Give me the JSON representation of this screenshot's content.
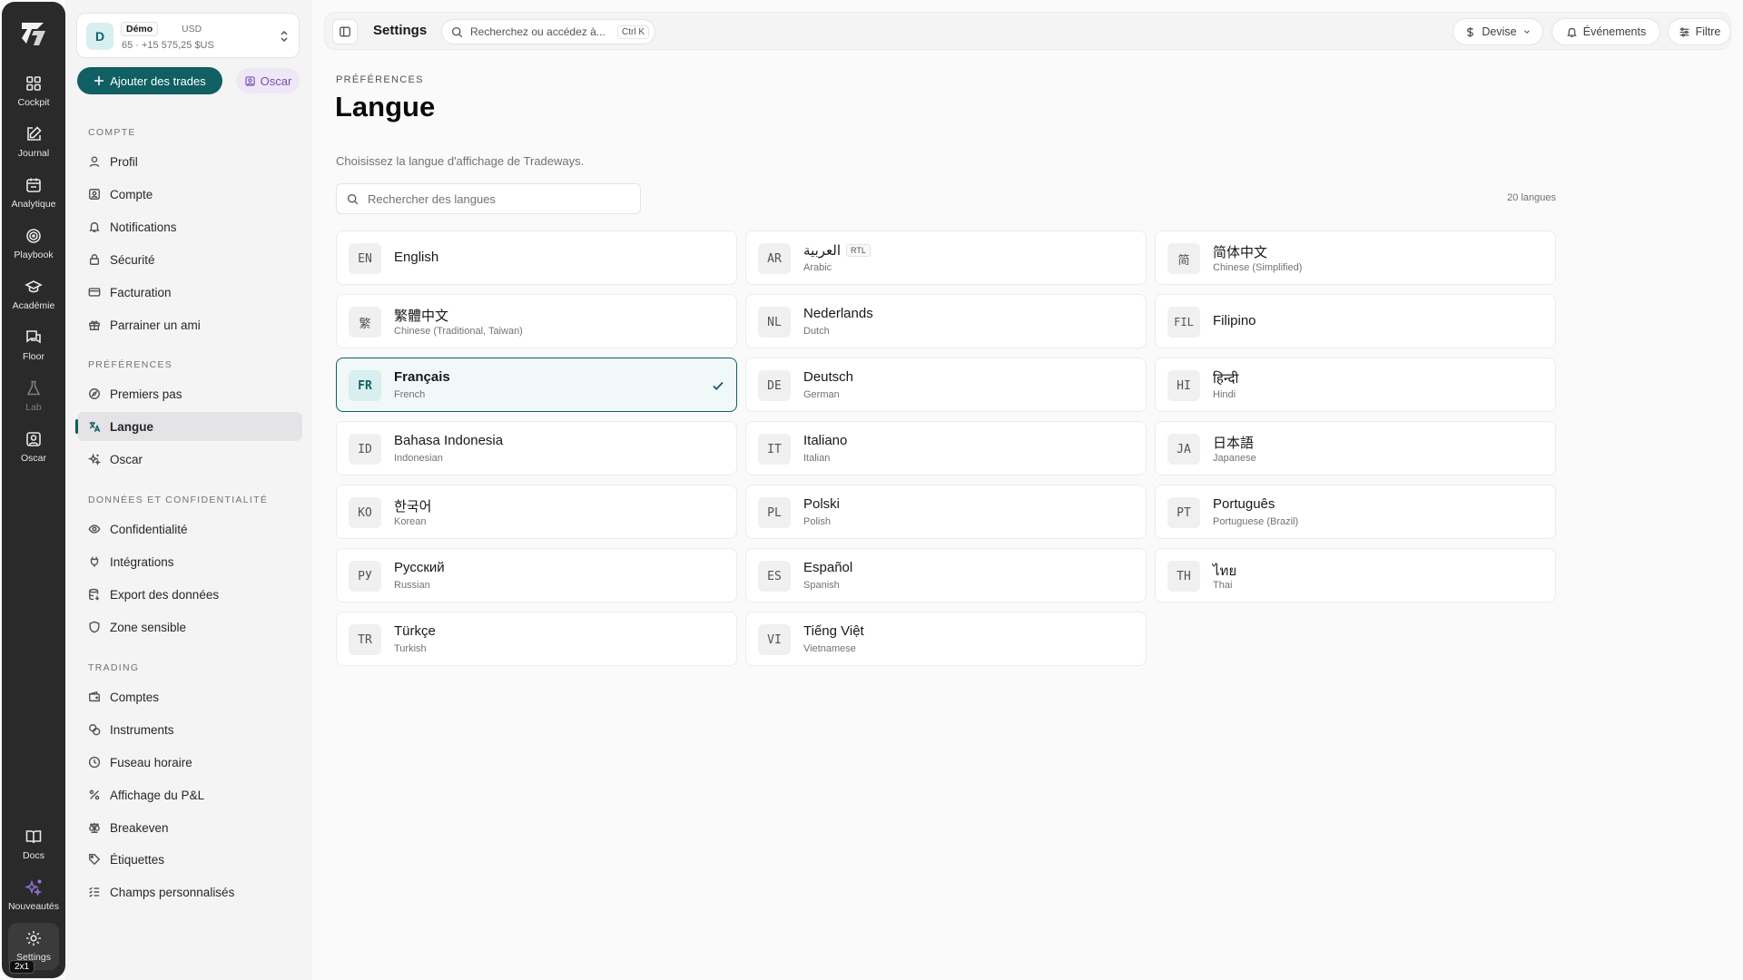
{
  "rail": {
    "items": [
      {
        "label": "Cockpit",
        "icon": "grid-icon"
      },
      {
        "label": "Journal",
        "icon": "edit-icon"
      },
      {
        "label": "Analytique",
        "icon": "calendar-icon"
      },
      {
        "label": "Playbook",
        "icon": "target-icon"
      },
      {
        "label": "Académie",
        "icon": "graduation-cap-icon"
      },
      {
        "label": "Floor",
        "icon": "chat-icon"
      },
      {
        "label": "Lab",
        "icon": "flask-icon"
      },
      {
        "label": "Oscar",
        "icon": "portrait-icon"
      }
    ],
    "bottom": [
      {
        "label": "Docs",
        "icon": "book-icon"
      },
      {
        "label": "Nouveautés",
        "icon": "sparkle-icon"
      },
      {
        "label": "Settings",
        "icon": "gear-icon"
      }
    ],
    "badge": "2x1"
  },
  "account": {
    "avatar": "D",
    "tag": "Démo",
    "currency": "USD",
    "subline": "65 · +15 575,25 $US"
  },
  "actions": {
    "add_trades": "Ajouter des trades",
    "oscar": "Oscar"
  },
  "sidebar": {
    "sections": [
      {
        "title": "COMPTE",
        "items": [
          "Profil",
          "Compte",
          "Notifications",
          "Sécurité",
          "Facturation",
          "Parrainer un ami"
        ]
      },
      {
        "title": "PRÉFÉRENCES",
        "items": [
          "Premiers pas",
          "Langue",
          "Oscar"
        ]
      },
      {
        "title": "DONNÉES ET CONFIDENTIALITÉ",
        "items": [
          "Confidentialité",
          "Intégrations",
          "Export des données",
          "Zone sensible"
        ]
      },
      {
        "title": "TRADING",
        "items": [
          "Comptes",
          "Instruments",
          "Fuseau horaire",
          "Affichage du P&L",
          "Breakeven",
          "Étiquettes",
          "Champs personnalisés"
        ]
      }
    ]
  },
  "topbar": {
    "title": "Settings",
    "search_placeholder": "Recherchez ou accédez à...",
    "shortcut": "Ctrl K",
    "currency": "Devise",
    "events": "Événements",
    "filter": "Filtre"
  },
  "page": {
    "eyebrow": "PRÉFÉRENCES",
    "title": "Langue",
    "description": "Choisissez la langue d'affichage de Tradeways.",
    "search_placeholder": "Rechercher des langues",
    "count": "20 langues"
  },
  "languages": [
    {
      "code": "EN",
      "native": "English",
      "english": ""
    },
    {
      "code": "AR",
      "native": "العربية",
      "english": "Arabic",
      "badge": "RTL"
    },
    {
      "code": "简",
      "native": "简体中文",
      "english": "Chinese (Simplified)"
    },
    {
      "code": "繁",
      "native": "繁體中文",
      "english": "Chinese (Traditional, Taiwan)"
    },
    {
      "code": "NL",
      "native": "Nederlands",
      "english": "Dutch"
    },
    {
      "code": "FIL",
      "native": "Filipino",
      "english": ""
    },
    {
      "code": "FR",
      "native": "Français",
      "english": "French",
      "selected": true
    },
    {
      "code": "DE",
      "native": "Deutsch",
      "english": "German"
    },
    {
      "code": "HI",
      "native": "हिन्दी",
      "english": "Hindi"
    },
    {
      "code": "ID",
      "native": "Bahasa Indonesia",
      "english": "Indonesian"
    },
    {
      "code": "IT",
      "native": "Italiano",
      "english": "Italian"
    },
    {
      "code": "JA",
      "native": "日本語",
      "english": "Japanese"
    },
    {
      "code": "KO",
      "native": "한국어",
      "english": "Korean"
    },
    {
      "code": "PL",
      "native": "Polski",
      "english": "Polish"
    },
    {
      "code": "PT",
      "native": "Português",
      "english": "Portuguese (Brazil)"
    },
    {
      "code": "РУ",
      "native": "Русский",
      "english": "Russian"
    },
    {
      "code": "ES",
      "native": "Español",
      "english": "Spanish"
    },
    {
      "code": "TH",
      "native": "ไทย",
      "english": "Thai"
    },
    {
      "code": "TR",
      "native": "Türkçe",
      "english": "Turkish"
    },
    {
      "code": "VI",
      "native": "Tiếng Việt",
      "english": "Vietnamese"
    }
  ],
  "colors": {
    "accent": "#0f5f63",
    "oscar": "#7a4fb0",
    "rail": "#2a2a2a"
  }
}
